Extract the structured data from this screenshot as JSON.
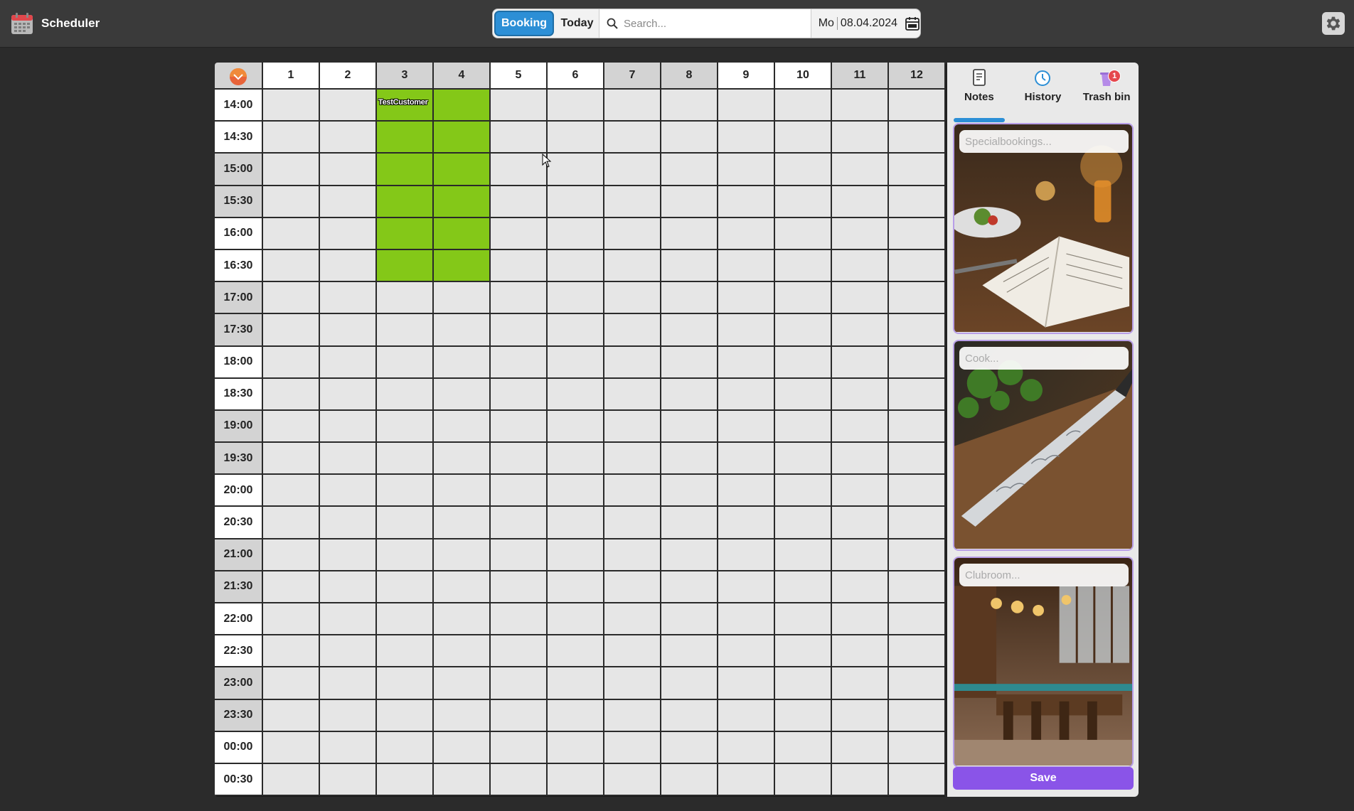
{
  "app": {
    "title": "Scheduler"
  },
  "toolbar": {
    "booking_label": "Booking",
    "today_label": "Today",
    "search_placeholder": "Search...",
    "day": "Mo",
    "date": "08.04.2024"
  },
  "grid": {
    "columns": [
      "1",
      "2",
      "3",
      "4",
      "5",
      "6",
      "7",
      "8",
      "9",
      "10",
      "11",
      "12"
    ],
    "times": [
      "14:00",
      "14:30",
      "15:00",
      "15:30",
      "16:00",
      "16:30",
      "17:00",
      "17:30",
      "18:00",
      "18:30",
      "19:00",
      "19:30",
      "20:00",
      "20:30",
      "21:00",
      "21:30",
      "22:00",
      "22:30",
      "23:00",
      "23:30",
      "00:00",
      "00:30"
    ],
    "booking": {
      "customer": "TestCustomer",
      "columns": [
        "3",
        "4"
      ],
      "start": "14:00",
      "end": "16:30",
      "color": "#84c818"
    }
  },
  "panel": {
    "tabs": [
      {
        "label": "Notes",
        "icon": "notes-icon",
        "active": true
      },
      {
        "label": "History",
        "icon": "clock-icon",
        "active": false
      },
      {
        "label": "Trash bin",
        "icon": "trash-icon",
        "active": false,
        "badge": "1"
      }
    ],
    "notes": [
      {
        "placeholder": "Specialbookings...",
        "image": "restaurant-table-photo"
      },
      {
        "placeholder": "Cook...",
        "image": "knife-herbs-photo"
      },
      {
        "placeholder": "Clubroom...",
        "image": "dining-room-photo"
      }
    ],
    "save_label": "Save"
  },
  "colors": {
    "accent": "#2c8fd6",
    "save": "#8a54e8",
    "booked": "#84c818",
    "badge": "#e5484d"
  }
}
